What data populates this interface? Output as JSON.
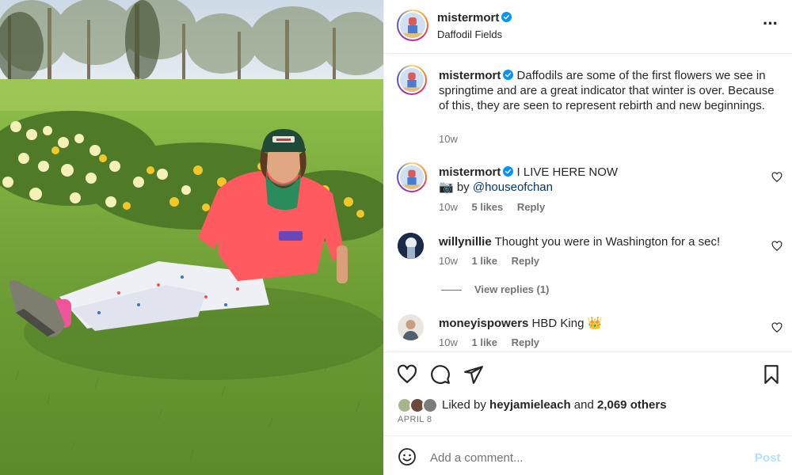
{
  "post": {
    "username": "mistermort",
    "location": "Daffodil Fields",
    "more_icon": "more-horizontal-icon"
  },
  "caption": {
    "username": "mistermort",
    "text": "Daffodils are some of the first flowers we see in springtime and are a great indicator that winter is over. Because of this, they are seen to represent rebirth and new beginnings.",
    "time": "10w"
  },
  "comments": [
    {
      "username": "mistermort",
      "text_1": "I LIVE HERE NOW",
      "text_2_prefix": "📷 by ",
      "mention": "@houseofchan",
      "time": "10w",
      "likes": "5 likes",
      "reply": "Reply"
    },
    {
      "username": "willynillie",
      "text": "Thought you were in Washington for a sec!",
      "time": "10w",
      "likes": "1 like",
      "reply": "Reply"
    },
    {
      "username": "moneyispowers",
      "text": "HBD King 👑",
      "time": "10w",
      "likes": "1 like",
      "reply": "Reply"
    }
  ],
  "view_replies": "View replies (1)",
  "likes": {
    "prefix": "Liked by",
    "user": "heyjamieleach",
    "middle": "and",
    "others": "2,069 others"
  },
  "date": "APRIL 8",
  "add_comment": {
    "placeholder": "Add a comment...",
    "post_label": "Post"
  },
  "colors": {
    "accent_link": "#00376b",
    "post_disabled": "#b2dffc",
    "verified_blue": "#0095f6",
    "muted_text": "#737373"
  }
}
